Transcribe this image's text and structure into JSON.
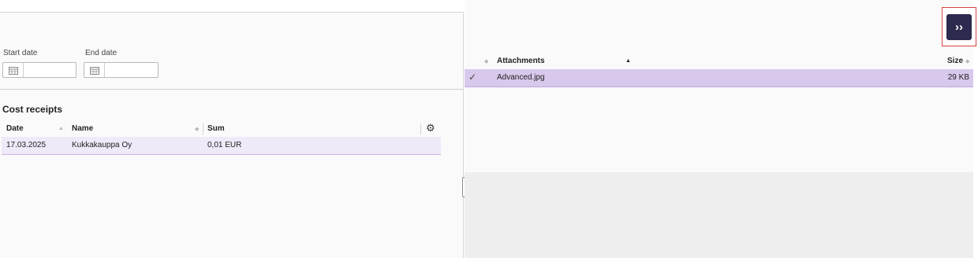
{
  "filters": {
    "start_date_label": "Start date",
    "start_date_value": "",
    "end_date_label": "End date",
    "end_date_value": ""
  },
  "cost_receipts": {
    "title": "Cost receipts",
    "columns": [
      "Date",
      "Name",
      "Sum"
    ],
    "rows": [
      {
        "date": "17.03.2025",
        "name": "Kukkakauppa Oy",
        "sum": "0,01 EUR"
      }
    ]
  },
  "attachments": {
    "columns": [
      "Attachments",
      "Size"
    ],
    "rows": [
      {
        "name": "Advanced.jpg",
        "size": "29 KB",
        "selected": true
      }
    ]
  },
  "expand_button": {
    "label": "››"
  },
  "icons": {
    "calendar": "calendar-icon",
    "settings": "gear-icon",
    "selected": "checkmark-icon"
  },
  "colors": {
    "accent": "#2c2a4e",
    "highlight_border": "#d64541",
    "selected_row": "#d8c8eb",
    "row_tint": "#efe9f8"
  }
}
